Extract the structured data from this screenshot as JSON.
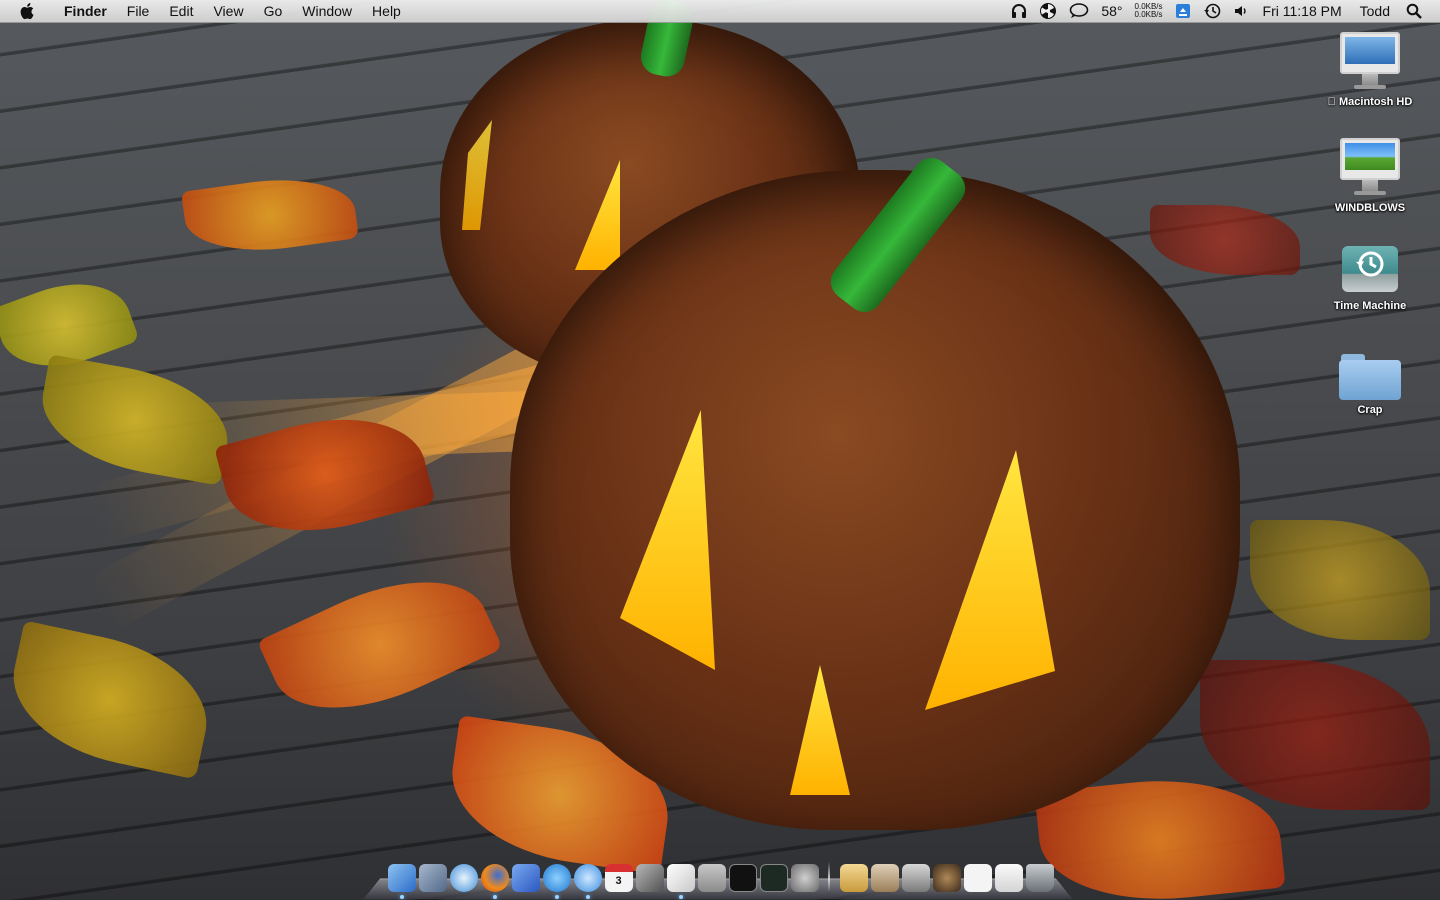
{
  "menubar": {
    "app_name": "Finder",
    "menus": [
      "File",
      "Edit",
      "View",
      "Go",
      "Window",
      "Help"
    ],
    "status": {
      "weather": "58°",
      "net_up": "0.0KB/s",
      "net_down": "0.0KB/s",
      "clock": "Fri 11:18 PM",
      "user": "Todd"
    }
  },
  "desktop_icons": [
    {
      "label": "Macintosh HD",
      "icon": "imac-icon"
    },
    {
      "label": "WINDBLOWS",
      "icon": "imac-windows-icon"
    },
    {
      "label": "Time Machine",
      "icon": "time-machine-drive-icon"
    },
    {
      "label": "Crap",
      "icon": "folder-icon"
    }
  ],
  "dock": {
    "calendar_day": "3",
    "apps": [
      {
        "name": "finder",
        "color": "#3d7fd6",
        "running": true
      },
      {
        "name": "mail",
        "color": "#5a78a8",
        "running": false
      },
      {
        "name": "safari",
        "color": "#3f8ed8",
        "running": false
      },
      {
        "name": "firefox",
        "color": "#e0641e",
        "running": true
      },
      {
        "name": "xcode",
        "color": "#3a6fd0",
        "running": false
      },
      {
        "name": "ichat",
        "color": "#2f8fe0",
        "running": true
      },
      {
        "name": "itunes",
        "color": "#4fa3e8",
        "running": true
      },
      {
        "name": "ical",
        "color": "#f2f2f2",
        "running": false
      },
      {
        "name": "iphoto",
        "color": "#7a7a7a",
        "running": false
      },
      {
        "name": "textedit",
        "color": "#e8e8e8",
        "running": true
      },
      {
        "name": "calculator",
        "color": "#a8a8a8",
        "running": false
      },
      {
        "name": "terminal",
        "color": "#222222",
        "running": false
      },
      {
        "name": "activity-monitor",
        "color": "#1d2a24",
        "running": false
      },
      {
        "name": "system-preferences",
        "color": "#8c8c8c",
        "running": false
      }
    ],
    "stacks": [
      {
        "name": "documents-stack",
        "color": "#e4c27a"
      },
      {
        "name": "applications-stack",
        "color": "#c9b08c"
      },
      {
        "name": "downloads-stack",
        "color": "#b0b0b0"
      },
      {
        "name": "pictures-stack",
        "color": "#7a5a3a"
      },
      {
        "name": "file-stack",
        "color": "#f0f0f0"
      },
      {
        "name": "document-stack",
        "color": "#e8e8e8"
      },
      {
        "name": "trash",
        "color": "#9aa0a6"
      }
    ]
  }
}
